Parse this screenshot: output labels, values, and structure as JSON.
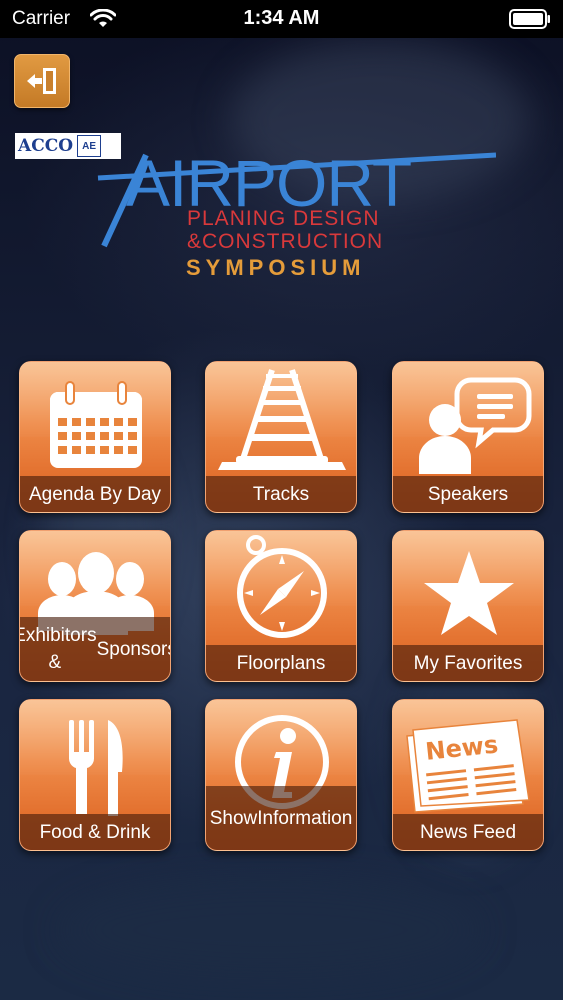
{
  "status_bar": {
    "carrier": "Carrier",
    "time": "1:34 AM"
  },
  "header": {
    "exit_icon": "exit-door-icon",
    "acco_text": "ACCO",
    "ae_text": "AE",
    "logo_title": "AIRPORT",
    "logo_line1": "PLANING DESIGN",
    "logo_line2": "&CONSTRUCTION",
    "logo_line3": "SYMPOSIUM"
  },
  "colors": {
    "tile_orange": "#ef8c4a",
    "logo_blue": "#3a84d6",
    "logo_red": "#d9393b",
    "logo_orange": "#e59c3a"
  },
  "menu": [
    {
      "label": "Agenda By Day",
      "icon": "calendar-icon"
    },
    {
      "label": "Tracks",
      "icon": "railroad-tracks-icon"
    },
    {
      "label": "Speakers",
      "icon": "speaker-speech-bubble-icon"
    },
    {
      "label_line1": "Exhibitors &",
      "label_line2": "Sponsors",
      "icon": "people-group-icon"
    },
    {
      "label": "Floorplans",
      "icon": "compass-icon"
    },
    {
      "label": "My Favorites",
      "icon": "star-icon"
    },
    {
      "label": "Food & Drink",
      "icon": "fork-knife-icon"
    },
    {
      "label_line1": "Show",
      "label_line2": "Information",
      "icon": "info-icon"
    },
    {
      "label": "News Feed",
      "icon": "newspaper-icon"
    }
  ]
}
